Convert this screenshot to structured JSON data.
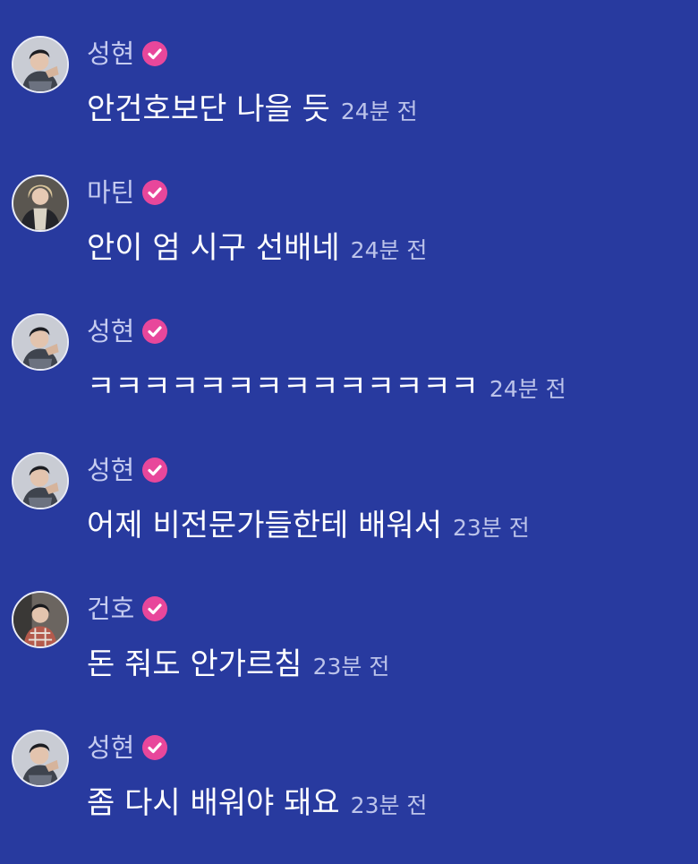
{
  "colors": {
    "background": "#283a9f",
    "name_text": "#c5cbf0",
    "message_text": "#ffffff",
    "time_text": "#bcc3ea",
    "verified_badge": "#e8479b"
  },
  "messages": [
    {
      "name": "성현",
      "verified": true,
      "avatar": "avatar-seonghyeon",
      "text": "안건호보단 나을 듯",
      "time": "24분 전"
    },
    {
      "name": "마틴",
      "verified": true,
      "avatar": "avatar-martin",
      "text": "안이 엄 시구 선배네",
      "time": "24분 전"
    },
    {
      "name": "성현",
      "verified": true,
      "avatar": "avatar-seonghyeon",
      "text": "ㅋㅋㅋㅋㅋㅋㅋㅋㅋㅋㅋㅋㅋㅋ",
      "time": "24분 전"
    },
    {
      "name": "성현",
      "verified": true,
      "avatar": "avatar-seonghyeon",
      "text": "어제 비전문가들한테 배워서",
      "time": "23분 전"
    },
    {
      "name": "건호",
      "verified": true,
      "avatar": "avatar-geonho",
      "text": "돈 줘도 안가르침",
      "time": "23분 전"
    },
    {
      "name": "성현",
      "verified": true,
      "avatar": "avatar-seonghyeon",
      "text": "좀 다시 배워야 돼요",
      "time": "23분 전"
    }
  ]
}
